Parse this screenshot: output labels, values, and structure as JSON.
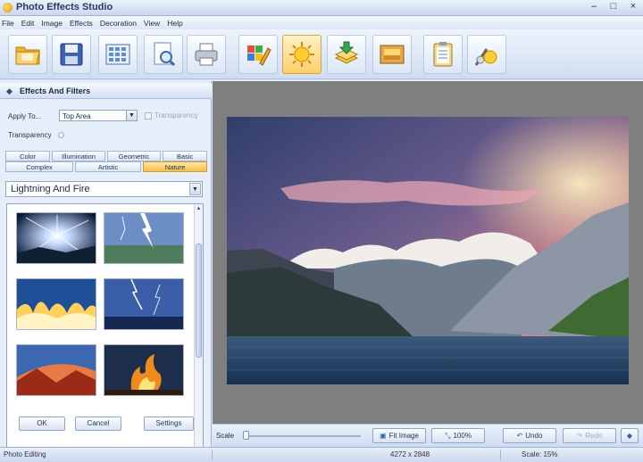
{
  "window": {
    "title": "Photo Effects Studio"
  },
  "menu": [
    "File",
    "Edit",
    "Image",
    "Effects",
    "Decoration",
    "View",
    "Help"
  ],
  "toolbar": {
    "buttons": [
      "folder-open-icon",
      "save-icon",
      "grid-icon",
      "page-preview-icon",
      "printer-icon",
      "color-edit-icon",
      "sun-icon",
      "download-stack-icon",
      "image-frame-icon",
      "clipboard-icon",
      "magic-effects-icon"
    ],
    "active_index": 6
  },
  "panel": {
    "title": "Effects And Filters",
    "apply_to_label": "Apply To...",
    "apply_to_value": "Top Area",
    "transparency_checkbox_label": "Transparency",
    "transparency_label": "Transparency",
    "tabs_row1": [
      "Color",
      "Illumination",
      "Geometric",
      "Basic"
    ],
    "tabs_row2": [
      "Complex",
      "Artistic",
      "Nature"
    ],
    "active_tab": "Nature",
    "category": "Lightning And Fire",
    "buttons": {
      "ok": "OK",
      "cancel": "Cancel",
      "settings": "Settings"
    }
  },
  "bottom": {
    "scale_label": "Scale",
    "fit_image": "Fit Image",
    "zoom": "100%",
    "undo": "Undo",
    "redo": "Redo"
  },
  "status": {
    "mode": "Photo Editing",
    "dimensions": "4272 x 2848",
    "scale": "Scale: 15%"
  },
  "colors": {
    "accent": "#f6bd4a",
    "panel": "#e6eef9",
    "canvas": "#7f7f7f"
  }
}
